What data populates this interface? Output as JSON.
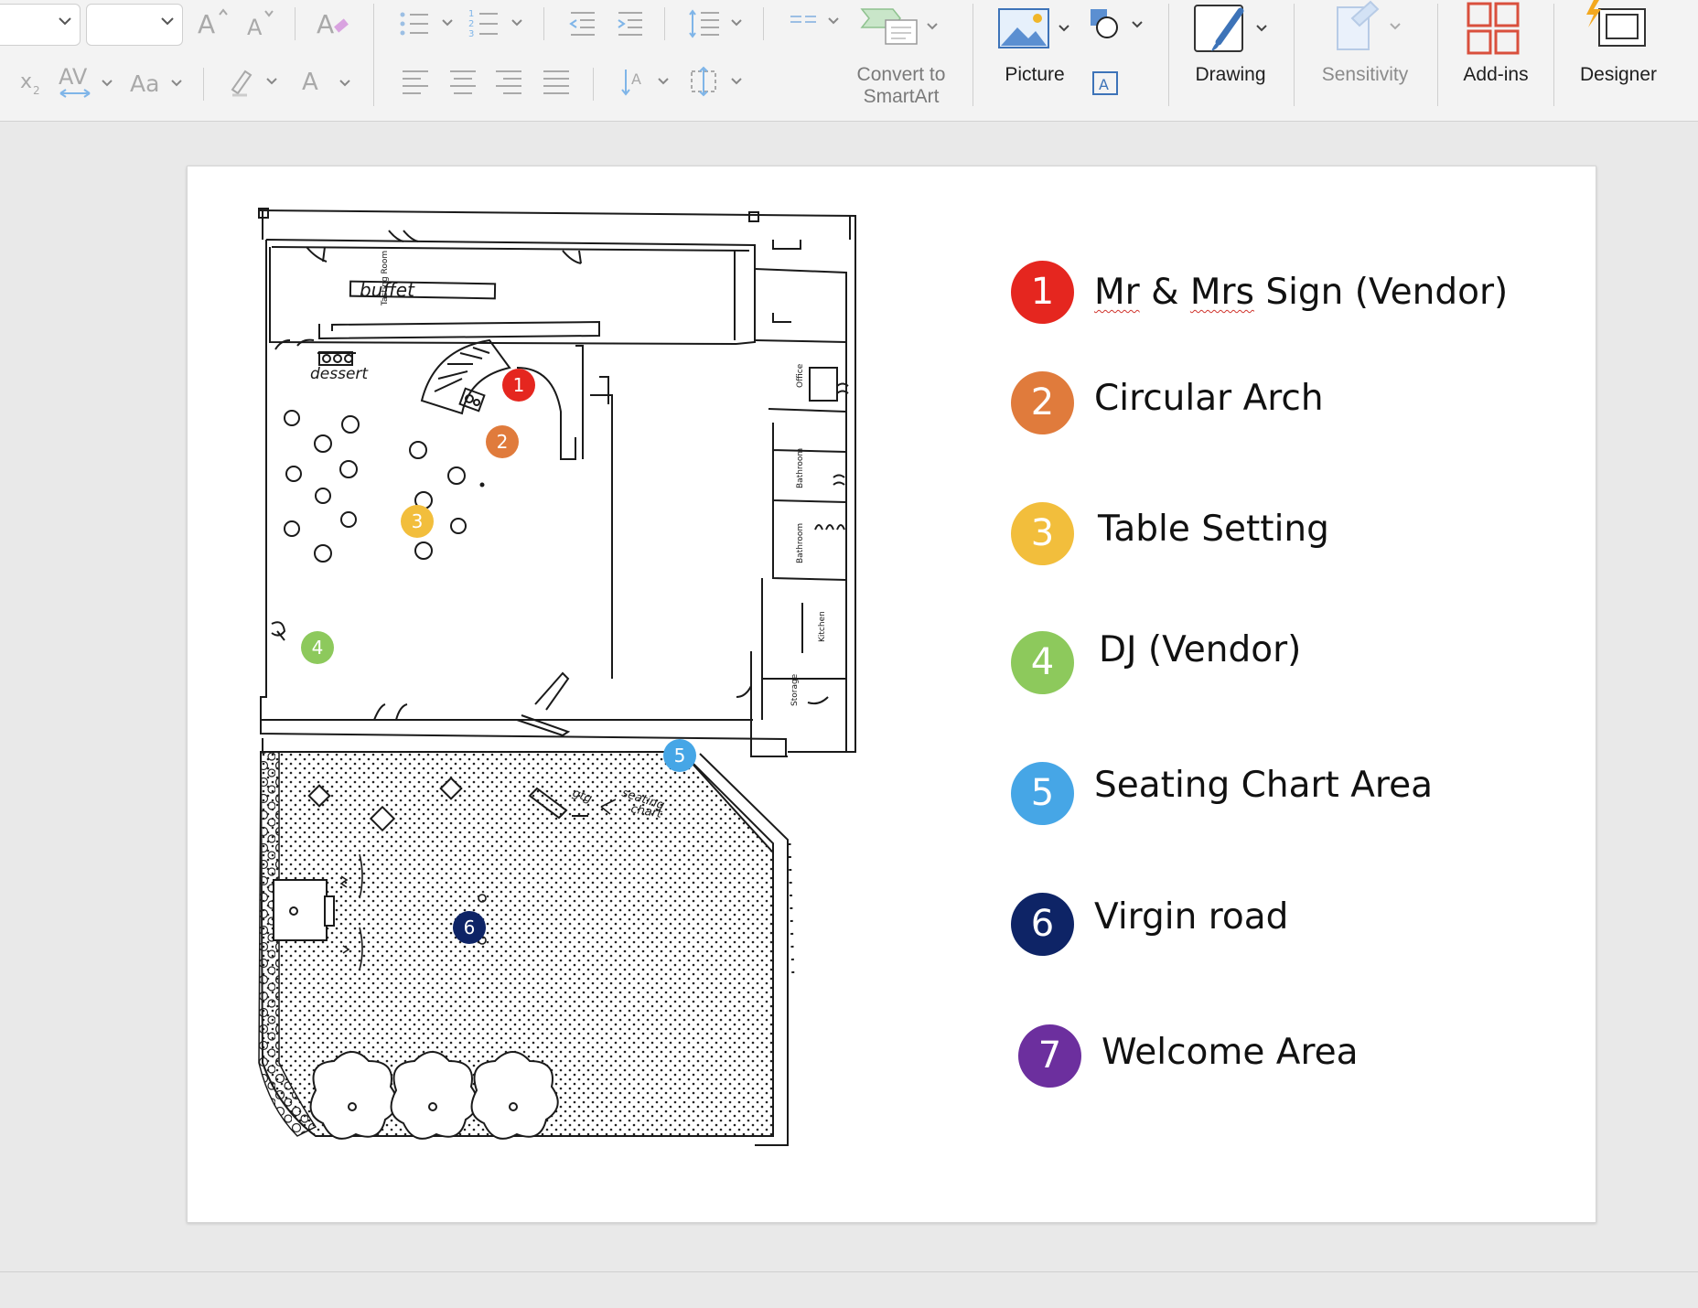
{
  "ribbon": {
    "font_subscript_icon": "subscript-icon",
    "smartart_label_line1": "Convert to",
    "smartart_label_line2": "SmartArt",
    "picture_label": "Picture",
    "drawing_label": "Drawing",
    "sensitivity_label": "Sensitivity",
    "addins_label": "Add-ins",
    "designer_label": "Designer"
  },
  "floorplan": {
    "labels": {
      "buffet": "buffet",
      "tasting_room": "Tasting Room",
      "dessert": "dessert",
      "office": "Office",
      "bathroom1": "Bathroom",
      "bathroom2": "Bathroom",
      "kitchen": "Kitchen",
      "storage": "Storage",
      "seating_chart_line1": "seating",
      "seating_chart_line2": "chart",
      "gtg": "gtg"
    },
    "markers": [
      {
        "number": "1",
        "color": "#e5261f"
      },
      {
        "number": "2",
        "color": "#e07b3c"
      },
      {
        "number": "3",
        "color": "#f2be3c"
      },
      {
        "number": "4",
        "color": "#8dc95c"
      },
      {
        "number": "5",
        "color": "#46a6e6"
      },
      {
        "number": "6",
        "color": "#0e2466"
      }
    ]
  },
  "legend": [
    {
      "number": "1",
      "text_a": "Mr",
      "text_b": " & ",
      "text_c": "Mrs",
      "text_d": " Sign (Vendor)",
      "color": "#e5261f"
    },
    {
      "number": "2",
      "text": "Circular Arch",
      "color": "#e07b3c"
    },
    {
      "number": "3",
      "text": "Table Setting",
      "color": "#f2be3c"
    },
    {
      "number": "4",
      "text": "DJ (Vendor)",
      "color": "#8dc95c"
    },
    {
      "number": "5",
      "text": "Seating Chart Area",
      "color": "#46a6e6"
    },
    {
      "number": "6",
      "text": "Virgin road",
      "color": "#0e2466"
    },
    {
      "number": "7",
      "text": "Welcome Area",
      "color": "#6c2f9e"
    }
  ]
}
